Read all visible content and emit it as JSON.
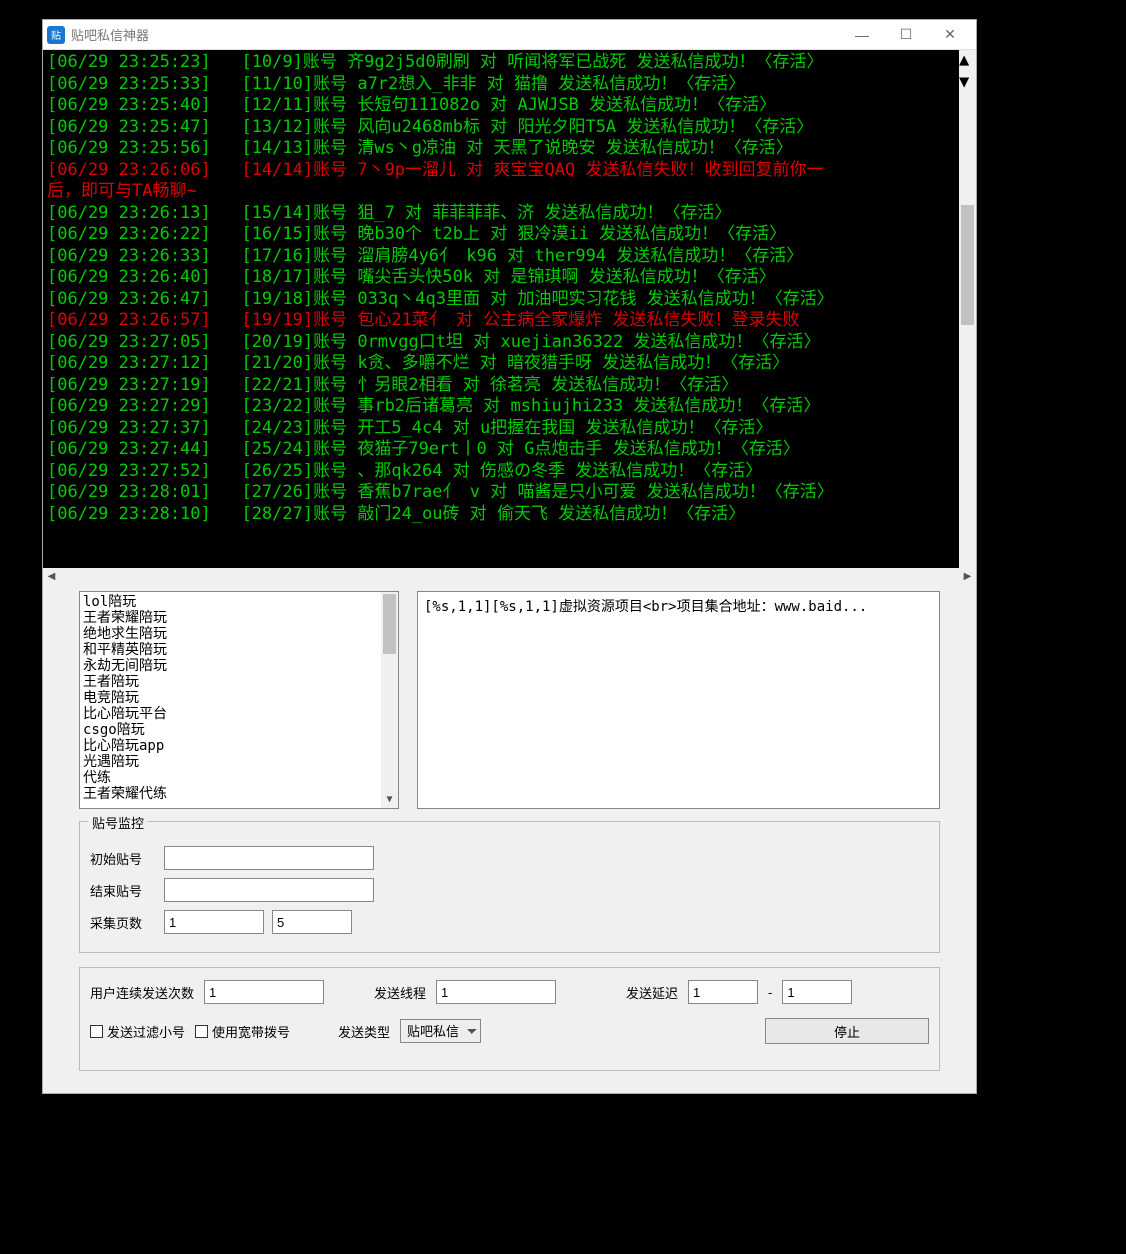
{
  "window": {
    "title": "贴吧私信神器"
  },
  "log_lines": [
    {
      "err": false,
      "text": "[06/29 23:25:23]   [10/9]账号 齐9g2j5d0刷刷 对 听闻将军已战死 发送私信成功！〈存活〉"
    },
    {
      "err": false,
      "text": "[06/29 23:25:33]   [11/10]账号 a7r2想入_非非 对 猫撸 发送私信成功！〈存活〉"
    },
    {
      "err": false,
      "text": "[06/29 23:25:40]   [12/11]账号 长短句111082o 对 AJWJSB 发送私信成功！〈存活〉"
    },
    {
      "err": false,
      "text": "[06/29 23:25:47]   [13/12]账号 风向u2468mb标 对 阳光夕阳T5A 发送私信成功！〈存活〉"
    },
    {
      "err": false,
      "text": "[06/29 23:25:56]   [14/13]账号 清ws丶g凉油 对 天黑了说晚安 发送私信成功！〈存活〉"
    },
    {
      "err": true,
      "text": "[06/29 23:26:06]   [14/14]账号 7丶9p一溜儿 对 爽宝宝QAQ 发送私信失败！收到回复前你一"
    },
    {
      "err": true,
      "text": "后，即可与TA畅聊~"
    },
    {
      "err": false,
      "text": "[06/29 23:26:13]   [15/14]账号 狙_7 对 菲菲菲菲、济 发送私信成功！〈存活〉"
    },
    {
      "err": false,
      "text": "[06/29 23:26:22]   [16/15]账号 晚b30个 t2b上 对 狠冷漠ii 发送私信成功！〈存活〉"
    },
    {
      "err": false,
      "text": "[06/29 23:26:33]   [17/16]账号 溜肩膀4y6亻 k96 对 ther994 发送私信成功！〈存活〉"
    },
    {
      "err": false,
      "text": "[06/29 23:26:40]   [18/17]账号 嘴尖舌头快50k 对 是锦琪啊 发送私信成功！〈存活〉"
    },
    {
      "err": false,
      "text": "[06/29 23:26:47]   [19/18]账号 033q丶4q3里面 对 加油吧实习花钱 发送私信成功！〈存活〉"
    },
    {
      "err": true,
      "text": "[06/29 23:26:57]   [19/19]账号 包心21菜亻 对 公主病全家爆炸 发送私信失败！登录失败"
    },
    {
      "err": false,
      "text": "[06/29 23:27:05]   [20/19]账号 0rmvgg口t坦 对 xuejian36322 发送私信成功！〈存活〉"
    },
    {
      "err": false,
      "text": "[06/29 23:27:12]   [21/20]账号 k贪、多嚼不烂 对 暗夜猎手呀 发送私信成功！〈存活〉"
    },
    {
      "err": false,
      "text": "[06/29 23:27:19]   [22/21]账号 忄另眼2相看 对 徐茗亮 发送私信成功！〈存活〉"
    },
    {
      "err": false,
      "text": "[06/29 23:27:29]   [23/22]账号 事rb2后诸葛亮 对 mshiujhi233 发送私信成功！〈存活〉"
    },
    {
      "err": false,
      "text": "[06/29 23:27:37]   [24/23]账号 开工5_4c4 对 u把握在我国 发送私信成功！〈存活〉"
    },
    {
      "err": false,
      "text": "[06/29 23:27:44]   [25/24]账号 夜猫子79ert丨0 对 G点炮击手 发送私信成功！〈存活〉"
    },
    {
      "err": false,
      "text": "[06/29 23:27:52]   [26/25]账号 、那qk264 对 伤感の冬季 发送私信成功！〈存活〉"
    },
    {
      "err": false,
      "text": "[06/29 23:28:01]   [27/26]账号 香蕉b7rae亻 v 对 喵酱是只小可爱 发送私信成功！〈存活〉"
    },
    {
      "err": false,
      "text": "[06/29 23:28:10]   [28/27]账号 敲门24_ou砖 对 偷天飞 发送私信成功！〈存活〉"
    }
  ],
  "keyword_list": [
    "lol陪玩",
    "王者荣耀陪玩",
    "绝地求生陪玩",
    "和平精英陪玩",
    "永劫无间陪玩",
    "王者陪玩",
    "电竞陪玩",
    "比心陪玩平台",
    "csgo陪玩",
    "比心陪玩app",
    "光遇陪玩",
    "代练",
    "王者荣耀代练"
  ],
  "message_preview": "[%s,1,1][%s,1,1]虚拟资源项目<br>项目集合地址：www.baid...",
  "monitor": {
    "legend": "贴号监控",
    "start_label": "初始贴号",
    "end_label": "结束贴号",
    "pages_label": "采集页数",
    "start_value": "",
    "end_value": "",
    "pages_from": "1",
    "pages_to": "5"
  },
  "bottom": {
    "send_count_label": "用户连续发送次数",
    "send_count_value": "1",
    "threads_label": "发送线程",
    "threads_value": "1",
    "delay_label": "发送延迟",
    "delay_from": "1",
    "delay_sep": "-",
    "delay_to": "1",
    "filter_checkbox": "发送过滤小号",
    "dial_checkbox": "使用宽带拨号",
    "send_type_label": "发送类型",
    "send_type_value": "贴吧私信",
    "stop_button": "停止"
  }
}
